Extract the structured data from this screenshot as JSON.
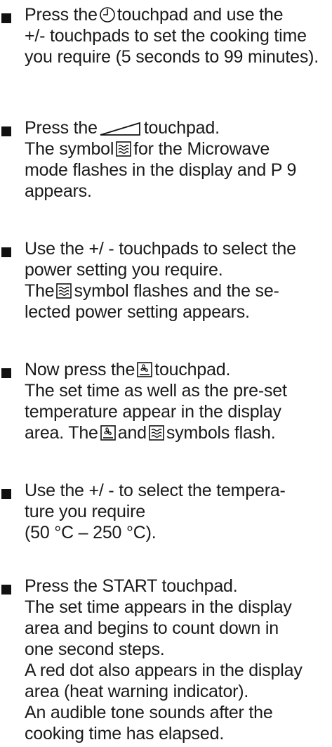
{
  "steps": [
    {
      "lines": [
        [
          "Press the",
          "clock-icon",
          "touchpad and use the"
        ],
        [
          "+/- touchpads to set the cooking time"
        ],
        [
          "you require (5 seconds to 99 minutes)."
        ]
      ]
    },
    {
      "lines": [
        [
          "Press the",
          "wedge-icon",
          "touchpad."
        ],
        [
          "The symbol",
          "microwave-icon",
          "for the Microwave"
        ],
        [
          "mode flashes in the display and P 9"
        ],
        [
          "appears."
        ]
      ]
    },
    {
      "lines": [
        [
          "Use the +/ - touchpads to select the"
        ],
        [
          "power setting you require."
        ],
        [
          "The",
          "microwave-icon",
          "symbol flashes and the se-"
        ],
        [
          "lected power setting appears."
        ]
      ]
    },
    {
      "lines": [
        [
          "Now press the",
          "fan-heat-icon",
          "touchpad."
        ],
        [
          "The set time as well as the pre-set"
        ],
        [
          "temperature appear in the display"
        ],
        [
          "area. The",
          "fan-heat-icon",
          "and",
          "microwave-icon",
          "symbols flash."
        ]
      ]
    },
    {
      "lines": [
        [
          "Use the +/ - to select the tempera-"
        ],
        [
          "ture you require"
        ],
        [
          "(50 °C – 250 °C)."
        ]
      ]
    },
    {
      "lines": [
        [
          "Press the START touchpad."
        ],
        [
          "The set time appears in the display"
        ],
        [
          "area and begins to count down in"
        ],
        [
          "one second steps."
        ],
        [
          "A red dot also appears in the display"
        ],
        [
          "area (heat warning indicator)."
        ],
        [
          "An audible tone sounds after the"
        ],
        [
          "cooking time has elapsed."
        ]
      ]
    }
  ]
}
